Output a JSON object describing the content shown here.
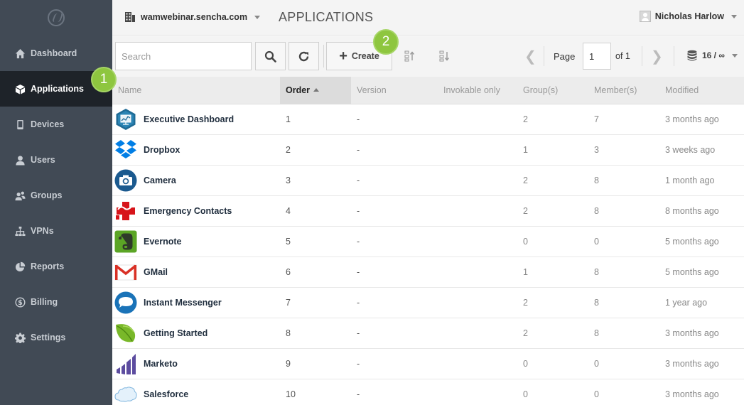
{
  "sidebar": {
    "items": [
      {
        "label": "Dashboard",
        "icon": "home-icon",
        "active": false
      },
      {
        "label": "Applications",
        "icon": "box-icon",
        "active": true
      },
      {
        "label": "Devices",
        "icon": "phone-icon",
        "active": false
      },
      {
        "label": "Users",
        "icon": "user-icon",
        "active": false
      },
      {
        "label": "Groups",
        "icon": "group-icon",
        "active": false
      },
      {
        "label": "VPNs",
        "icon": "network-icon",
        "active": false
      },
      {
        "label": "Reports",
        "icon": "pie-chart-icon",
        "active": false
      },
      {
        "label": "Billing",
        "icon": "dollar-icon",
        "active": false
      },
      {
        "label": "Settings",
        "icon": "gear-icon",
        "active": false
      }
    ]
  },
  "header": {
    "org": "wamwebinar.sencha.com",
    "title": "APPLICATIONS",
    "user": "Nicholas Harlow"
  },
  "toolbar": {
    "search_placeholder": "Search",
    "create_label": "Create",
    "page_label": "Page",
    "page_value": "1",
    "of_label": "of 1",
    "per_page": "16 / ∞"
  },
  "badges": {
    "one": "1",
    "two": "2"
  },
  "table": {
    "columns": {
      "name": "Name",
      "order": "Order",
      "version": "Version",
      "invokable": "Invokable only",
      "groups": "Group(s)",
      "members": "Member(s)",
      "modified": "Modified"
    },
    "rows": [
      {
        "name": "Executive Dashboard",
        "order": "1",
        "version": "-",
        "invokable": "",
        "groups": "2",
        "members": "7",
        "modified": "3 months ago",
        "icon": "executive-dashboard-icon"
      },
      {
        "name": "Dropbox",
        "order": "2",
        "version": "-",
        "invokable": "",
        "groups": "1",
        "members": "3",
        "modified": "3 weeks ago",
        "icon": "dropbox-icon"
      },
      {
        "name": "Camera",
        "order": "3",
        "version": "-",
        "invokable": "",
        "groups": "2",
        "members": "8",
        "modified": "1 month ago",
        "icon": "camera-icon"
      },
      {
        "name": "Emergency Contacts",
        "order": "4",
        "version": "-",
        "invokable": "",
        "groups": "2",
        "members": "8",
        "modified": "8 months ago",
        "icon": "emergency-icon"
      },
      {
        "name": "Evernote",
        "order": "5",
        "version": "-",
        "invokable": "",
        "groups": "0",
        "members": "0",
        "modified": "5 months ago",
        "icon": "evernote-icon"
      },
      {
        "name": "GMail",
        "order": "6",
        "version": "-",
        "invokable": "",
        "groups": "1",
        "members": "8",
        "modified": "5 months ago",
        "icon": "gmail-icon"
      },
      {
        "name": "Instant Messenger",
        "order": "7",
        "version": "-",
        "invokable": "",
        "groups": "2",
        "members": "8",
        "modified": "1 year ago",
        "icon": "chat-bubble-icon"
      },
      {
        "name": "Getting Started",
        "order": "8",
        "version": "-",
        "invokable": "",
        "groups": "2",
        "members": "8",
        "modified": "3 months ago",
        "icon": "leaf-icon"
      },
      {
        "name": "Marketo",
        "order": "9",
        "version": "-",
        "invokable": "",
        "groups": "0",
        "members": "0",
        "modified": "3 months ago",
        "icon": "marketo-icon"
      },
      {
        "name": "Salesforce",
        "order": "10",
        "version": "-",
        "invokable": "",
        "groups": "0",
        "members": "0",
        "modified": "3 months ago",
        "icon": "salesforce-cloud-icon"
      }
    ]
  },
  "colors": {
    "sidebar_bg": "#414a55",
    "sidebar_active_bg": "#1e2329",
    "badge_green": "#8ec63f"
  }
}
